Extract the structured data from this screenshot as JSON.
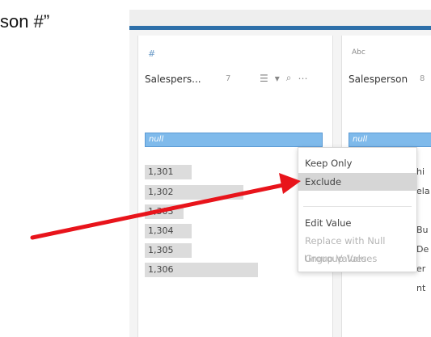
{
  "caption": "son #”",
  "column1": {
    "type_icon": "#",
    "field_name": "Salespers...",
    "count_badge": "7",
    "null_label": "null",
    "values": [
      {
        "label": "1,301",
        "share": 0.25
      },
      {
        "label": "1,302",
        "share": 0.55
      },
      {
        "label": "1,303",
        "share": 0.2
      },
      {
        "label": "1,304",
        "share": 0.25
      },
      {
        "label": "1,305",
        "share": 0.25
      },
      {
        "label": "1,306",
        "share": 0.6
      }
    ]
  },
  "column2": {
    "type_icon": "Abc",
    "field_name": "Salesperson",
    "count_badge": "8",
    "null_label": "null",
    "fragments": [
      "hi",
      "ela",
      "Bu",
      "De",
      "er",
      "nt"
    ]
  },
  "context_menu": {
    "items": [
      {
        "label": "Keep Only",
        "state": "normal"
      },
      {
        "label": "Exclude",
        "state": "highlighted"
      },
      {
        "label": "Edit Value",
        "state": "normal"
      },
      {
        "label": "Replace with Null",
        "state": "disabled"
      },
      {
        "label": "Group Values",
        "state": "disabled"
      },
      {
        "label": "Ungroup Values",
        "state": "disabled"
      }
    ]
  },
  "annotation": {
    "arrow_color": "#e8141b"
  },
  "colors": {
    "accent": "#2d6fa9",
    "selection": "#7fbaeb",
    "menu_highlight": "#d6d6d6"
  }
}
